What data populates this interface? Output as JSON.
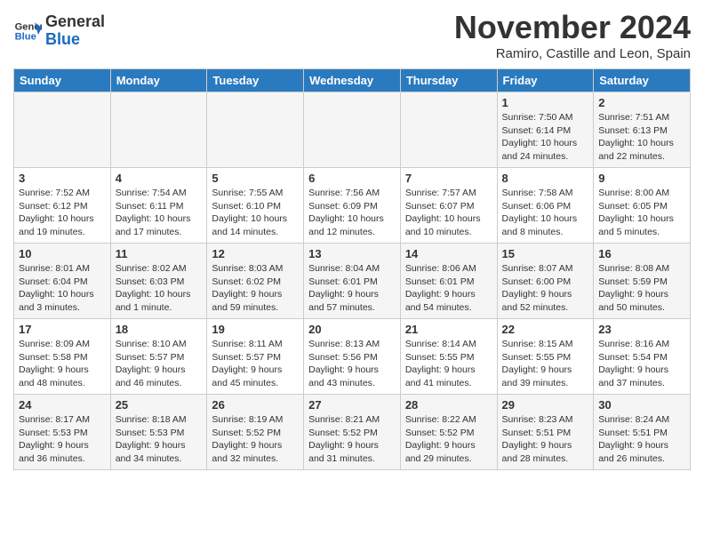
{
  "logo": {
    "line1": "General",
    "line2": "Blue"
  },
  "title": "November 2024",
  "subtitle": "Ramiro, Castille and Leon, Spain",
  "days_of_week": [
    "Sunday",
    "Monday",
    "Tuesday",
    "Wednesday",
    "Thursday",
    "Friday",
    "Saturday"
  ],
  "weeks": [
    [
      {
        "day": "",
        "info": ""
      },
      {
        "day": "",
        "info": ""
      },
      {
        "day": "",
        "info": ""
      },
      {
        "day": "",
        "info": ""
      },
      {
        "day": "",
        "info": ""
      },
      {
        "day": "1",
        "info": "Sunrise: 7:50 AM\nSunset: 6:14 PM\nDaylight: 10 hours and 24 minutes."
      },
      {
        "day": "2",
        "info": "Sunrise: 7:51 AM\nSunset: 6:13 PM\nDaylight: 10 hours and 22 minutes."
      }
    ],
    [
      {
        "day": "3",
        "info": "Sunrise: 7:52 AM\nSunset: 6:12 PM\nDaylight: 10 hours and 19 minutes."
      },
      {
        "day": "4",
        "info": "Sunrise: 7:54 AM\nSunset: 6:11 PM\nDaylight: 10 hours and 17 minutes."
      },
      {
        "day": "5",
        "info": "Sunrise: 7:55 AM\nSunset: 6:10 PM\nDaylight: 10 hours and 14 minutes."
      },
      {
        "day": "6",
        "info": "Sunrise: 7:56 AM\nSunset: 6:09 PM\nDaylight: 10 hours and 12 minutes."
      },
      {
        "day": "7",
        "info": "Sunrise: 7:57 AM\nSunset: 6:07 PM\nDaylight: 10 hours and 10 minutes."
      },
      {
        "day": "8",
        "info": "Sunrise: 7:58 AM\nSunset: 6:06 PM\nDaylight: 10 hours and 8 minutes."
      },
      {
        "day": "9",
        "info": "Sunrise: 8:00 AM\nSunset: 6:05 PM\nDaylight: 10 hours and 5 minutes."
      }
    ],
    [
      {
        "day": "10",
        "info": "Sunrise: 8:01 AM\nSunset: 6:04 PM\nDaylight: 10 hours and 3 minutes."
      },
      {
        "day": "11",
        "info": "Sunrise: 8:02 AM\nSunset: 6:03 PM\nDaylight: 10 hours and 1 minute."
      },
      {
        "day": "12",
        "info": "Sunrise: 8:03 AM\nSunset: 6:02 PM\nDaylight: 9 hours and 59 minutes."
      },
      {
        "day": "13",
        "info": "Sunrise: 8:04 AM\nSunset: 6:01 PM\nDaylight: 9 hours and 57 minutes."
      },
      {
        "day": "14",
        "info": "Sunrise: 8:06 AM\nSunset: 6:01 PM\nDaylight: 9 hours and 54 minutes."
      },
      {
        "day": "15",
        "info": "Sunrise: 8:07 AM\nSunset: 6:00 PM\nDaylight: 9 hours and 52 minutes."
      },
      {
        "day": "16",
        "info": "Sunrise: 8:08 AM\nSunset: 5:59 PM\nDaylight: 9 hours and 50 minutes."
      }
    ],
    [
      {
        "day": "17",
        "info": "Sunrise: 8:09 AM\nSunset: 5:58 PM\nDaylight: 9 hours and 48 minutes."
      },
      {
        "day": "18",
        "info": "Sunrise: 8:10 AM\nSunset: 5:57 PM\nDaylight: 9 hours and 46 minutes."
      },
      {
        "day": "19",
        "info": "Sunrise: 8:11 AM\nSunset: 5:57 PM\nDaylight: 9 hours and 45 minutes."
      },
      {
        "day": "20",
        "info": "Sunrise: 8:13 AM\nSunset: 5:56 PM\nDaylight: 9 hours and 43 minutes."
      },
      {
        "day": "21",
        "info": "Sunrise: 8:14 AM\nSunset: 5:55 PM\nDaylight: 9 hours and 41 minutes."
      },
      {
        "day": "22",
        "info": "Sunrise: 8:15 AM\nSunset: 5:55 PM\nDaylight: 9 hours and 39 minutes."
      },
      {
        "day": "23",
        "info": "Sunrise: 8:16 AM\nSunset: 5:54 PM\nDaylight: 9 hours and 37 minutes."
      }
    ],
    [
      {
        "day": "24",
        "info": "Sunrise: 8:17 AM\nSunset: 5:53 PM\nDaylight: 9 hours and 36 minutes."
      },
      {
        "day": "25",
        "info": "Sunrise: 8:18 AM\nSunset: 5:53 PM\nDaylight: 9 hours and 34 minutes."
      },
      {
        "day": "26",
        "info": "Sunrise: 8:19 AM\nSunset: 5:52 PM\nDaylight: 9 hours and 32 minutes."
      },
      {
        "day": "27",
        "info": "Sunrise: 8:21 AM\nSunset: 5:52 PM\nDaylight: 9 hours and 31 minutes."
      },
      {
        "day": "28",
        "info": "Sunrise: 8:22 AM\nSunset: 5:52 PM\nDaylight: 9 hours and 29 minutes."
      },
      {
        "day": "29",
        "info": "Sunrise: 8:23 AM\nSunset: 5:51 PM\nDaylight: 9 hours and 28 minutes."
      },
      {
        "day": "30",
        "info": "Sunrise: 8:24 AM\nSunset: 5:51 PM\nDaylight: 9 hours and 26 minutes."
      }
    ]
  ]
}
